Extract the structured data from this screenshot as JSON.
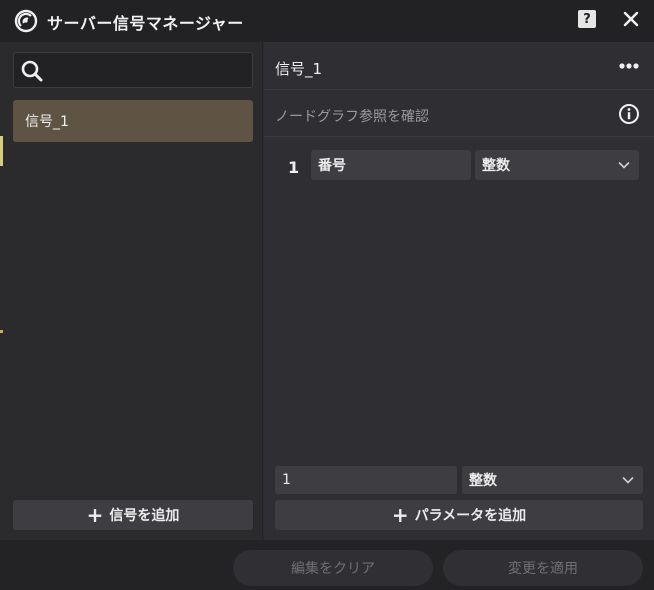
{
  "window": {
    "title": "サーバー信号マネージャー",
    "help_label": "?",
    "icons": {
      "app": "signal-radar-icon",
      "help": "help-icon",
      "close": "close-icon"
    }
  },
  "left_panel": {
    "search": {
      "placeholder": "",
      "value": ""
    },
    "signals": [
      {
        "label": "信号_1",
        "selected": true
      }
    ],
    "add_signal_label": "信号を追加"
  },
  "right_panel": {
    "signal_name": "信号_1",
    "node_graph_ref_label": "ノードグラフ参照を確認",
    "params": [
      {
        "index": "1",
        "name": "番号",
        "type": "整数"
      }
    ],
    "new_param": {
      "value": "1",
      "type": "整数"
    },
    "add_param_label": "パラメータを追加"
  },
  "footer": {
    "clear_label": "編集をクリア",
    "apply_label": "変更を適用"
  },
  "colors": {
    "selected_item": "#5f5443",
    "panel_bg": "#2b2b2e",
    "button_bg": "#3d3d42"
  }
}
